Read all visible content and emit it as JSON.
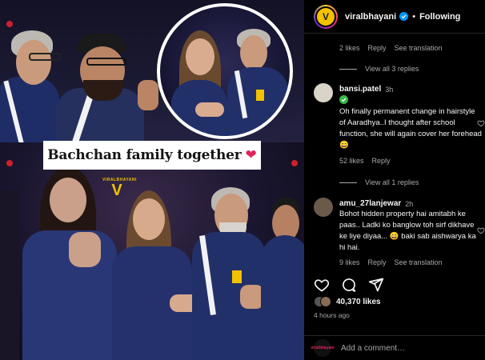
{
  "post": {
    "caption_overlay": "Bachchan family together",
    "watermark": "VIRALBHAYANI"
  },
  "header": {
    "username": "viralbhayani",
    "separator": "•",
    "follow_label": "Following"
  },
  "thread": {
    "top_reply_meta": {
      "likes": "2 likes",
      "reply": "Reply",
      "translate": "See translation"
    },
    "top_view_replies": "View all 3 replies",
    "comments": [
      {
        "user": "bansi.patel",
        "time": "3h",
        "text": "Oh finally permanent change in hairstyle of Aaradhya..I thought after school function, she will again cover her forehead 😄",
        "likes": "52 likes",
        "reply": "Reply",
        "view_replies": "View all 1 replies"
      },
      {
        "user": "amu_27lanjewar",
        "time": "2h",
        "text": "Bohot hidden property hai amitabh ke paas.. Ladki ko banglow toh sirf dikhave ke liye diyaa... 😄 baki sab aishwarya ka hi hai.",
        "likes": "9 likes",
        "reply": "Reply",
        "translate": "See translation"
      }
    ]
  },
  "footer": {
    "likes_count": "40,370 likes",
    "posted": "4 hours ago",
    "add_comment_placeholder": "Add a comment…",
    "viewer_avatar_text": "viralbhayani"
  },
  "colors": {
    "accent_yellow": "#f2c200",
    "heart_red": "#e0245e",
    "text_muted": "#a8a8a8"
  }
}
